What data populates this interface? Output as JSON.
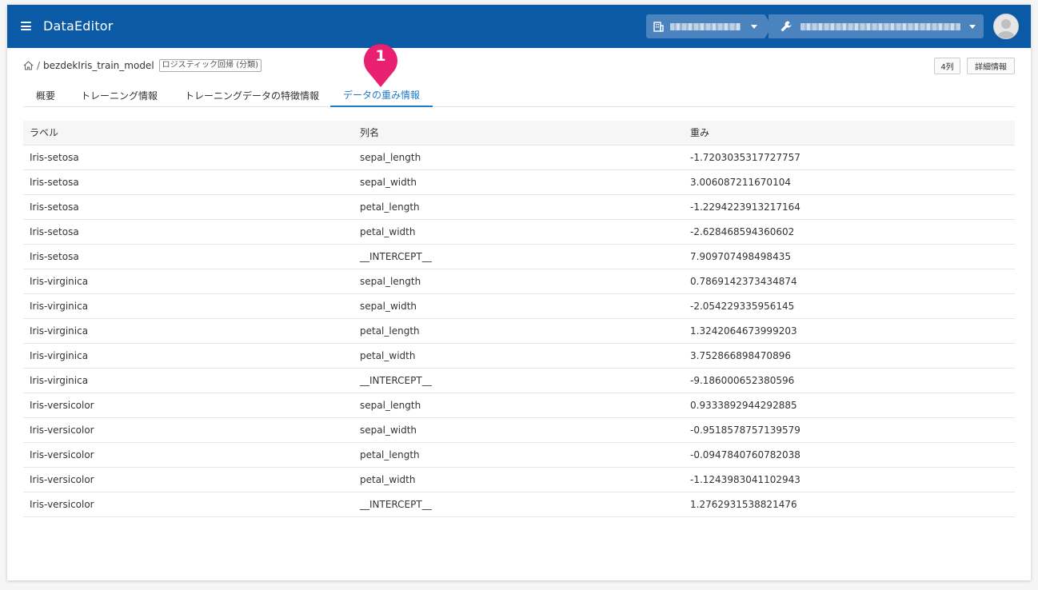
{
  "app": {
    "title": "DataEditor"
  },
  "header": {
    "org_selector": "",
    "project_selector": ""
  },
  "breadcrumb": {
    "model_name": "bezdekIris_train_model",
    "model_type": "ロジスティック回帰 (分類)",
    "separator": "/"
  },
  "actions": {
    "columns_button": "4列",
    "details_button": "詳細情報"
  },
  "tabs": [
    {
      "label": "概要",
      "active": false
    },
    {
      "label": "トレーニング情報",
      "active": false
    },
    {
      "label": "トレーニングデータの特徴情報",
      "active": false
    },
    {
      "label": "データの重み情報",
      "active": true
    }
  ],
  "annotation": {
    "marker": "1",
    "color": "#e8206f"
  },
  "table": {
    "headers": [
      "ラベル",
      "列名",
      "重み"
    ],
    "rows": [
      [
        "Iris-setosa",
        "sepal_length",
        "-1.7203035317727757"
      ],
      [
        "Iris-setosa",
        "sepal_width",
        "3.006087211670104"
      ],
      [
        "Iris-setosa",
        "petal_length",
        "-1.2294223913217164"
      ],
      [
        "Iris-setosa",
        "petal_width",
        "-2.628468594360602"
      ],
      [
        "Iris-setosa",
        "__INTERCEPT__",
        "7.909707498498435"
      ],
      [
        "Iris-virginica",
        "sepal_length",
        "0.7869142373434874"
      ],
      [
        "Iris-virginica",
        "sepal_width",
        "-2.054229335956145"
      ],
      [
        "Iris-virginica",
        "petal_length",
        "1.3242064673999203"
      ],
      [
        "Iris-virginica",
        "petal_width",
        "3.752866898470896"
      ],
      [
        "Iris-virginica",
        "__INTERCEPT__",
        "-9.186000652380596"
      ],
      [
        "Iris-versicolor",
        "sepal_length",
        "0.9333892944292885"
      ],
      [
        "Iris-versicolor",
        "sepal_width",
        "-0.9518578757139579"
      ],
      [
        "Iris-versicolor",
        "petal_length",
        "-0.0947840760782038"
      ],
      [
        "Iris-versicolor",
        "petal_width",
        "-1.1243983041102943"
      ],
      [
        "Iris-versicolor",
        "__INTERCEPT__",
        "1.2762931538821476"
      ]
    ]
  },
  "colors": {
    "header_bg": "#0b5aa5",
    "selector_bg": "#4a83bd",
    "tab_active": "#1f7ac9"
  },
  "icons": {
    "menu": "hamburger-icon",
    "org": "building-icon",
    "project": "wrench-icon",
    "home": "home-icon",
    "user": "avatar-icon"
  }
}
